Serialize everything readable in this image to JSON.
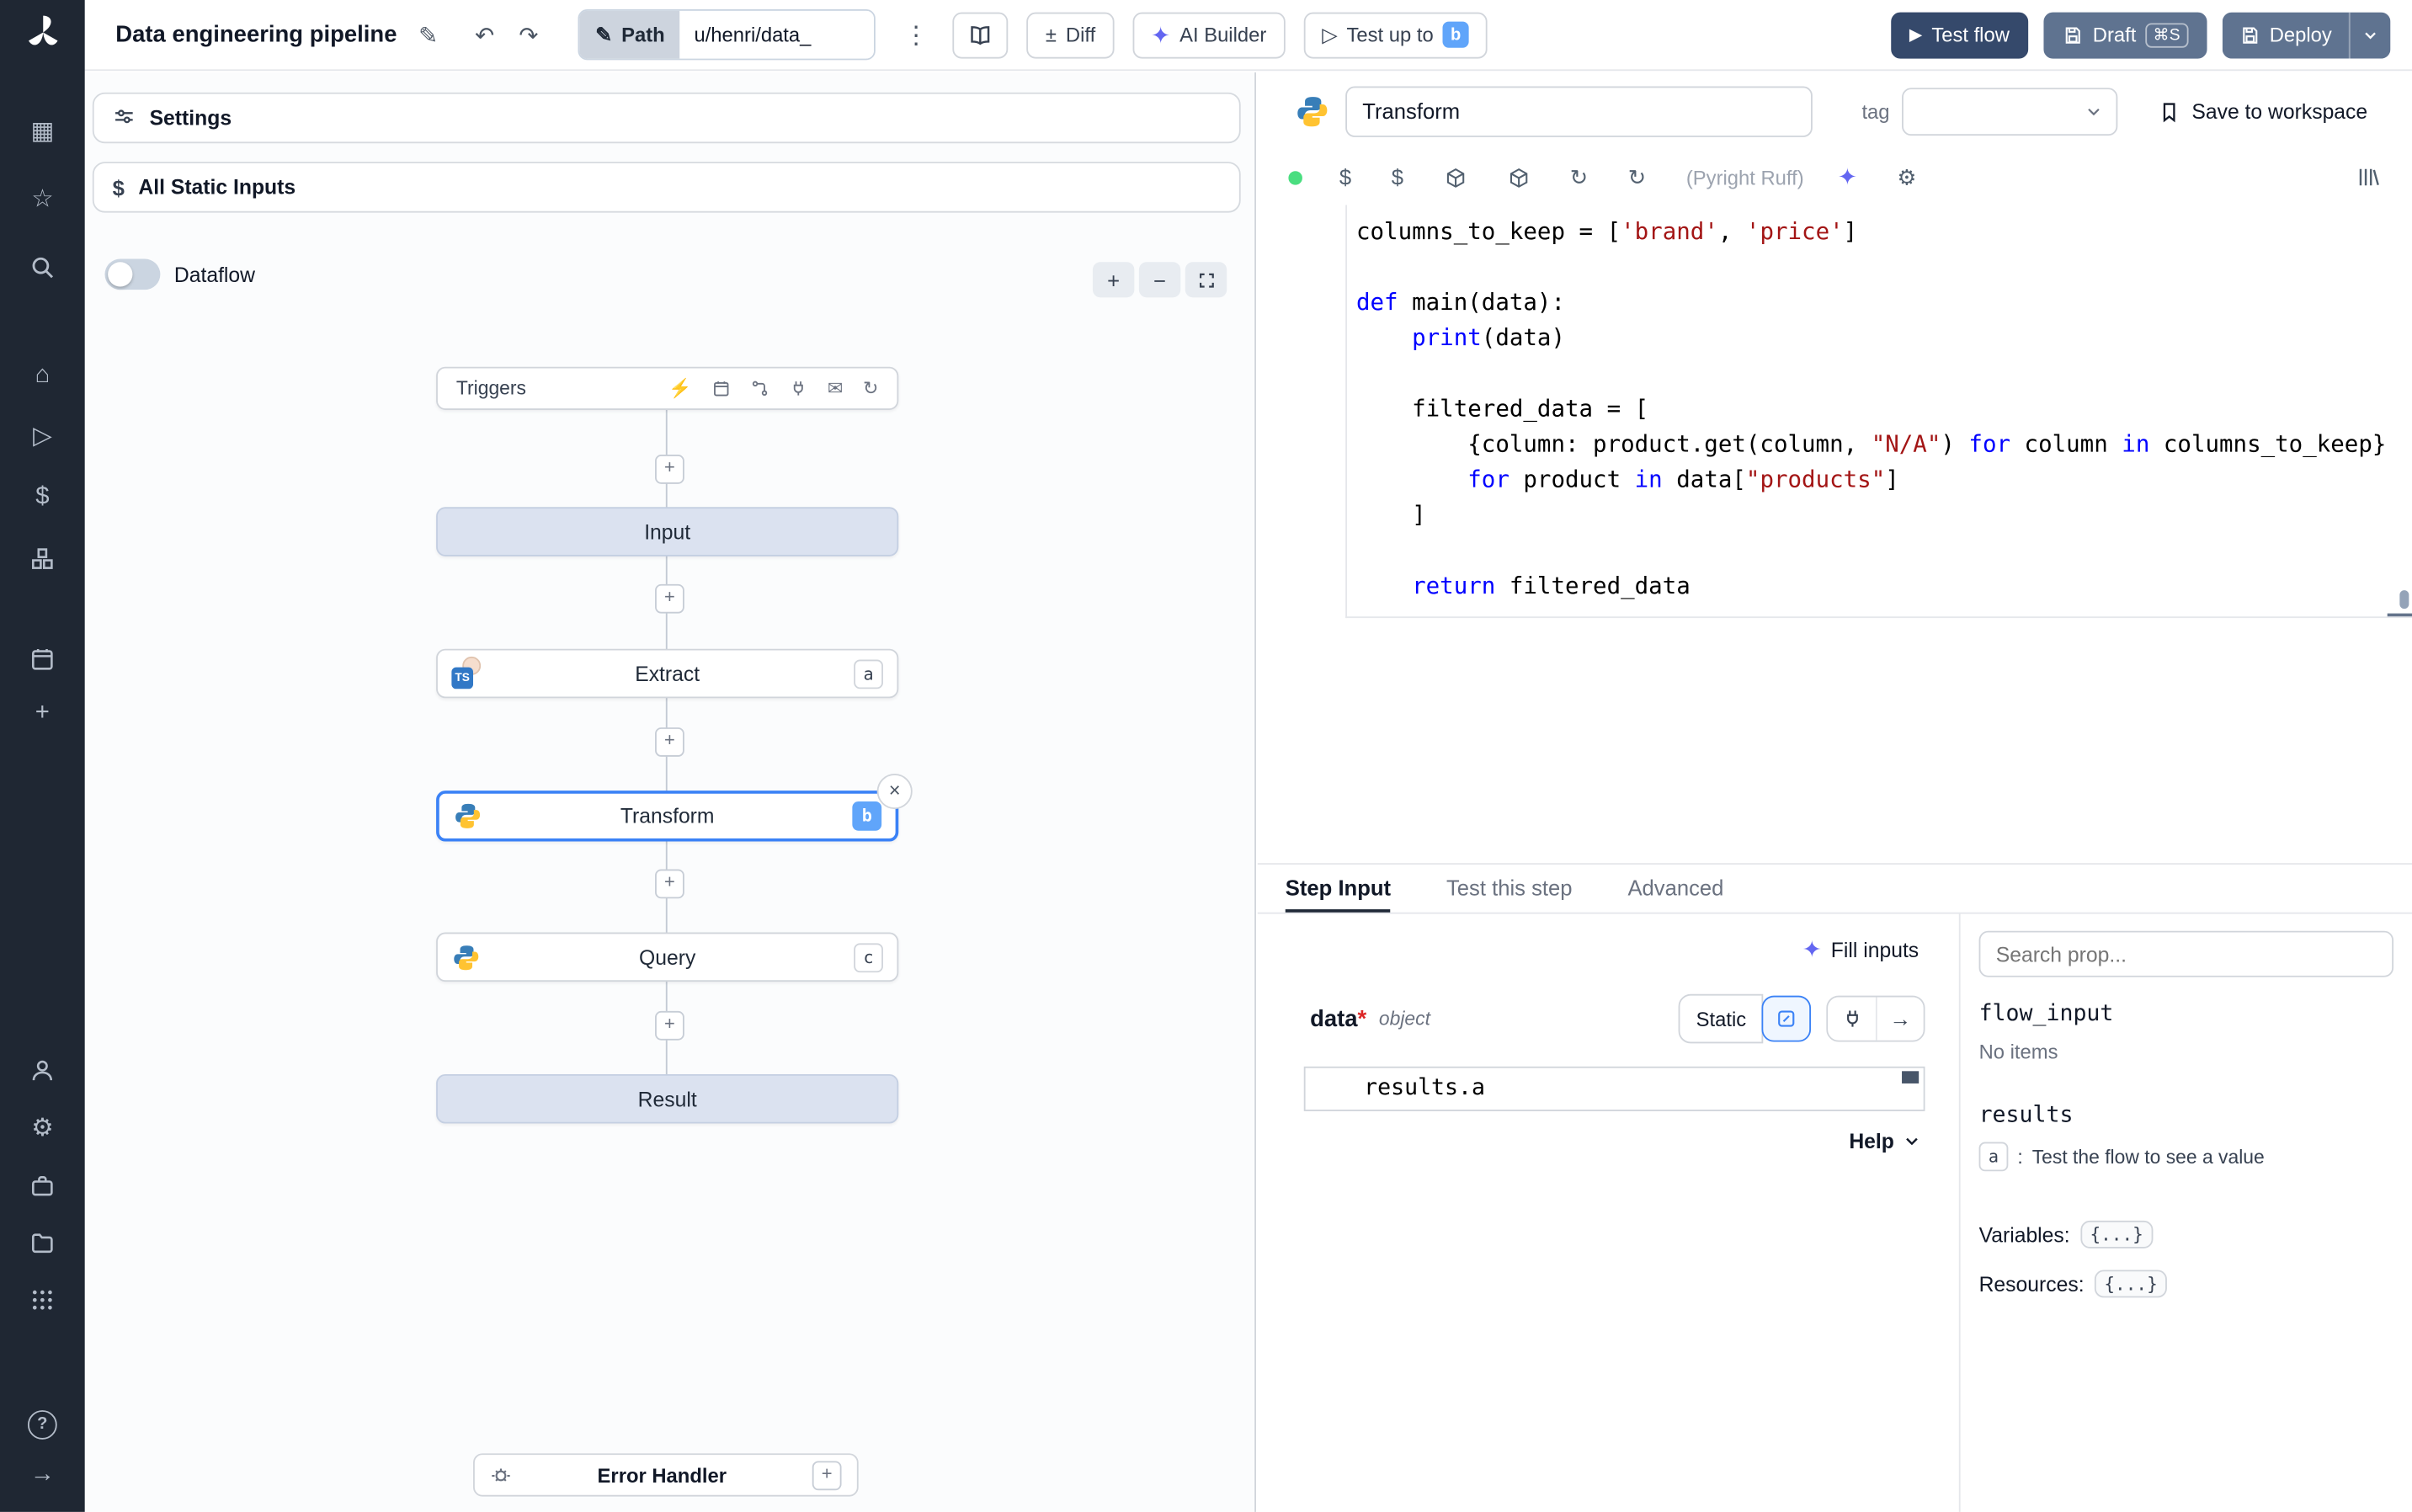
{
  "icons": {
    "pencil": "✎",
    "undo": "↶",
    "redo": "↷",
    "kebab": "⋮",
    "plusminus": "±",
    "sparkle": "✦",
    "play_outline": "▷",
    "play": "▶",
    "close": "×",
    "plus": "+",
    "minus": "−",
    "dollar": "$",
    "gear": "⚙",
    "refresh": "↻",
    "bolt": "⚡",
    "mail": "✉",
    "apps": "▦",
    "star": "☆",
    "home": "⌂",
    "help": "?",
    "arrow_right": "→"
  },
  "topbar": {
    "title": "Data engineering pipeline",
    "path": {
      "label": "Path",
      "value": "u/henri/data_"
    },
    "buttons": {
      "diff": "Diff",
      "ai_builder": "AI Builder",
      "test_up_to": "Test up to",
      "test_up_to_badge": "b",
      "test_flow": "Test flow",
      "draft": "Draft",
      "draft_shortcut": "⌘S",
      "deploy": "Deploy"
    }
  },
  "flow": {
    "settings": "Settings",
    "all_static_inputs": "All Static Inputs",
    "dataflow": "Dataflow",
    "triggers": "Triggers",
    "nodes": {
      "input": "Input",
      "extract": "Extract",
      "extract_badge": "a",
      "extract_lang": "TS",
      "transform": "Transform",
      "transform_badge": "b",
      "query": "Query",
      "query_badge": "c",
      "result": "Result"
    },
    "error_handler": "Error Handler"
  },
  "editor": {
    "step_name": "Transform",
    "tag_label": "tag",
    "save_to_workspace": "Save to workspace",
    "lint": "(Pyright Ruff)",
    "code_lines": [
      [
        {
          "c": "p",
          "t": "columns_to_keep = ["
        },
        {
          "c": "s",
          "t": "'brand'"
        },
        {
          "c": "p",
          "t": ", "
        },
        {
          "c": "s",
          "t": "'price'"
        },
        {
          "c": "p",
          "t": "]"
        }
      ],
      [],
      [
        {
          "c": "k",
          "t": "def"
        },
        {
          "c": "p",
          "t": " main(data):"
        }
      ],
      [
        {
          "c": "p",
          "t": "    "
        },
        {
          "c": "k",
          "t": "print"
        },
        {
          "c": "p",
          "t": "(data)"
        }
      ],
      [],
      [
        {
          "c": "p",
          "t": "    filtered_data = ["
        }
      ],
      [
        {
          "c": "p",
          "t": "        {column: product.get(column, "
        },
        {
          "c": "s",
          "t": "\"N/A\""
        },
        {
          "c": "p",
          "t": ") "
        },
        {
          "c": "k",
          "t": "for"
        },
        {
          "c": "p",
          "t": " column "
        },
        {
          "c": "k",
          "t": "in"
        },
        {
          "c": "p",
          "t": " columns_to_keep}"
        }
      ],
      [
        {
          "c": "p",
          "t": "        "
        },
        {
          "c": "k",
          "t": "for"
        },
        {
          "c": "p",
          "t": " product "
        },
        {
          "c": "k",
          "t": "in"
        },
        {
          "c": "p",
          "t": " data["
        },
        {
          "c": "s",
          "t": "\"products\""
        },
        {
          "c": "p",
          "t": "]"
        }
      ],
      [
        {
          "c": "p",
          "t": "    ]"
        }
      ],
      [],
      [
        {
          "c": "p",
          "t": "    "
        },
        {
          "c": "k",
          "t": "return"
        },
        {
          "c": "p",
          "t": " filtered_data"
        }
      ]
    ]
  },
  "tabs": {
    "step_input": "Step Input",
    "test_step": "Test this step",
    "advanced": "Advanced"
  },
  "step_input": {
    "fill_inputs": "Fill inputs",
    "arg_name": "data",
    "required_mark": "*",
    "arg_type": "object",
    "static": "Static",
    "value": "results.a",
    "help": "Help"
  },
  "props": {
    "search_placeholder": "Search prop...",
    "flow_input": "flow_input",
    "no_items": "No items",
    "results": "results",
    "result_badge": "a",
    "result_sep": ":",
    "result_text": "Test the flow to see a value",
    "variables_label": "Variables:",
    "variables_value": "{...}",
    "resources_label": "Resources:",
    "resources_value": "{...}"
  }
}
